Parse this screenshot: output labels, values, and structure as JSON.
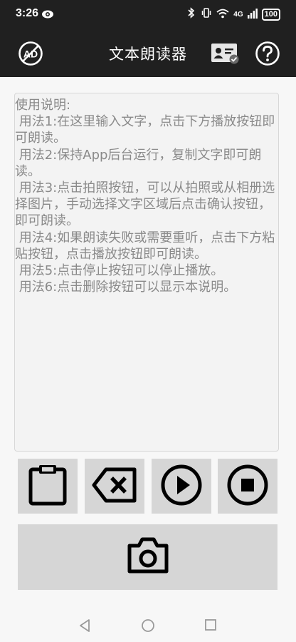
{
  "status_bar": {
    "time": "3:26",
    "network_label": "4G",
    "battery": "100"
  },
  "app_bar": {
    "title": "文本朗读器",
    "left_icon": "no-ads-icon",
    "right_icons": [
      "id-card-icon",
      "help-icon"
    ]
  },
  "instructions": {
    "lines": [
      "使用说明:",
      " 用法1:在这里输入文字，点击下方播放按钮即可朗读。",
      " 用法2:保持App后台运行，复制文字即可朗读。",
      " 用法3:点击拍照按钮，可以从拍照或从相册选择图片，手动选择文字区域后点击确认按钮，即可朗读。",
      " 用法4:如果朗读失败或需要重听，点击下方粘贴按钮，点击播放按钮即可朗读。",
      " 用法5:点击停止按钮可以停止播放。",
      " 用法6:点击删除按钮可以显示本说明。"
    ]
  },
  "toolbar": {
    "buttons": [
      "paste-icon",
      "backspace-icon",
      "play-icon",
      "stop-icon"
    ]
  },
  "camera": {
    "icon": "camera-icon"
  },
  "colors": {
    "top_bar": "#202020",
    "button_bg": "#d6d6d6",
    "text_gray": "#8a8a8a",
    "background": "#f7f7f7"
  }
}
